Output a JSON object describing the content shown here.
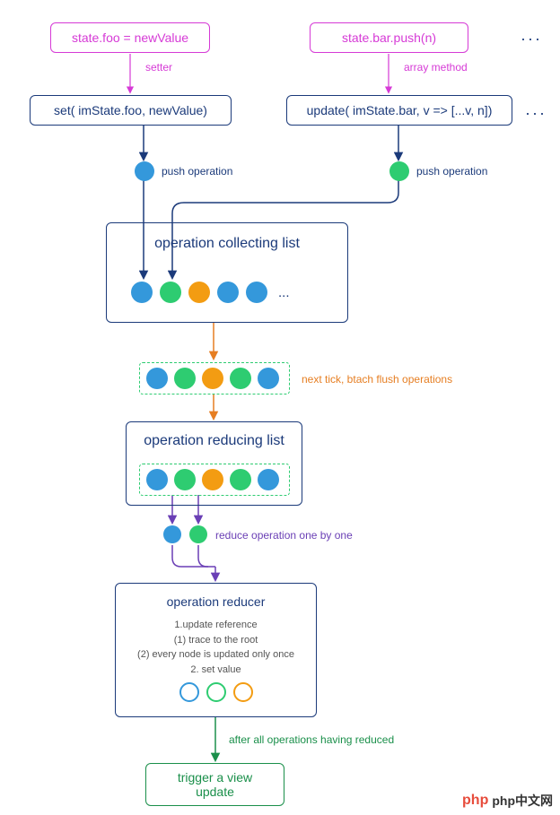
{
  "top": {
    "foo_code": "state.foo = newValue",
    "bar_code": "state.bar.push(n)",
    "setter_label": "setter",
    "array_method_label": "array method",
    "set_call": "set( imState.foo, newValue)",
    "update_call": "update( imState.bar, v => [...v, n])",
    "push_op_label": "push operation"
  },
  "collecting": {
    "title": "operation collecting list",
    "ellipsis": "..."
  },
  "batch": {
    "label": "next tick, btach flush operations"
  },
  "reducing": {
    "title": "operation reducing list"
  },
  "reduce_step": {
    "label": "reduce operation one by one"
  },
  "reducer": {
    "title": "operation reducer",
    "line1": "1.update reference",
    "line2": "(1)  trace to the root",
    "line3": "(2)  every node is updated only once",
    "line4": "2. set value"
  },
  "after": {
    "label": "after all operations having reduced"
  },
  "trigger": {
    "label": "trigger a view update"
  },
  "logo": {
    "text": "php中文网"
  }
}
